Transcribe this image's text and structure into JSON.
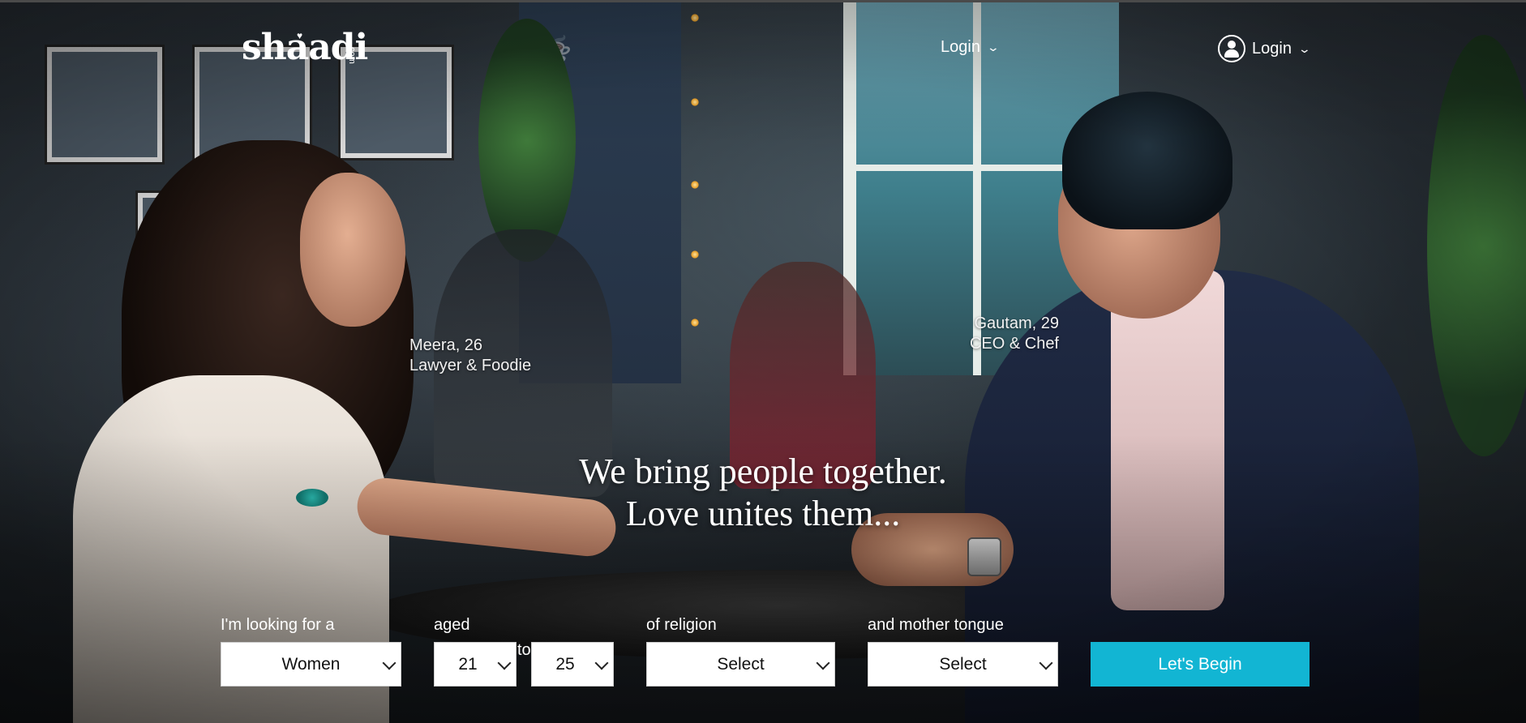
{
  "header": {
    "logo_text": "shaadi",
    "logo_suffix": ".com",
    "nav_login_label": "Login",
    "user_login_label": "Login"
  },
  "captions": {
    "woman_name": "Meera, 26",
    "woman_desc": "Lawyer & Foodie",
    "man_name": "Gautam, 29",
    "man_desc": "CEO & Chef"
  },
  "tagline": {
    "line1": "We bring people together.",
    "line2": "Love unites them..."
  },
  "search_form": {
    "looking_for_label": "I'm looking for a",
    "looking_for_value": "Women",
    "aged_label": "aged",
    "age_from_value": "21",
    "to_label": "to",
    "age_to_value": "25",
    "religion_label": "of religion",
    "religion_value": "Select",
    "mother_tongue_label": "and mother tongue",
    "mother_tongue_value": "Select",
    "submit_label": "Let's Begin"
  },
  "colors": {
    "accent": "#12b5d3",
    "text_light": "#ffffff"
  }
}
